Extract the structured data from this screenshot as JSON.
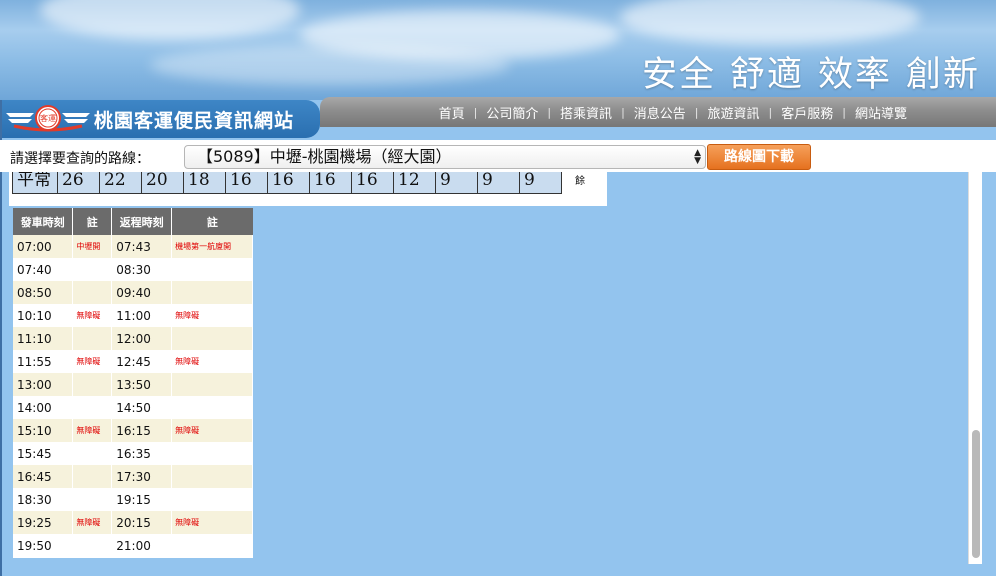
{
  "header": {
    "slogans": [
      "安全",
      "舒適",
      "效率",
      "創新"
    ]
  },
  "logo": {
    "title": "桃園客運便民資訊網站",
    "mark_text": "客運"
  },
  "nav": {
    "items": [
      "首頁",
      "公司簡介",
      "搭乘資訊",
      "消息公告",
      "旅遊資訊",
      "客戶服務",
      "網站導覽"
    ]
  },
  "route": {
    "label": "請選擇要查詢的路線：",
    "selected": "【5089】中壢-桃園機場（經大園）",
    "download_label": "路線圖下載"
  },
  "count_strip": {
    "cells": [
      "平常",
      "26",
      "22",
      "20",
      "18",
      "16",
      "16",
      "16",
      "16",
      "12",
      "9",
      "9",
      "9"
    ],
    "tail": "餘"
  },
  "timetable": {
    "headers": [
      "發車時刻",
      "註",
      "返程時刻",
      "註"
    ],
    "rows": [
      [
        "07:00",
        "中壢開",
        "07:43",
        "機場第一航廈開"
      ],
      [
        "07:40",
        "",
        "08:30",
        ""
      ],
      [
        "08:50",
        "",
        "09:40",
        ""
      ],
      [
        "10:10",
        "無障礙",
        "11:00",
        "無障礙"
      ],
      [
        "11:10",
        "",
        "12:00",
        ""
      ],
      [
        "11:55",
        "無障礙",
        "12:45",
        "無障礙"
      ],
      [
        "13:00",
        "",
        "13:50",
        ""
      ],
      [
        "14:00",
        "",
        "14:50",
        ""
      ],
      [
        "15:10",
        "無障礙",
        "16:15",
        "無障礙"
      ],
      [
        "15:45",
        "",
        "16:35",
        ""
      ],
      [
        "16:45",
        "",
        "17:30",
        ""
      ],
      [
        "18:30",
        "",
        "19:15",
        ""
      ],
      [
        "19:25",
        "無障礙",
        "20:15",
        "無障礙"
      ],
      [
        "19:50",
        "",
        "21:00",
        ""
      ]
    ]
  },
  "colors": {
    "page_bg": "#93c4ee",
    "nav_bg": "#8d8d8d",
    "logo_bg": "#2a6fb0",
    "button_orange": "#e5711f",
    "note_red": "#e00000",
    "row_alt": "#f6f2dc"
  },
  "icons": {
    "logo_emblem": "wing-emblem-icon",
    "select_arrows": "updown-arrows-icon"
  }
}
